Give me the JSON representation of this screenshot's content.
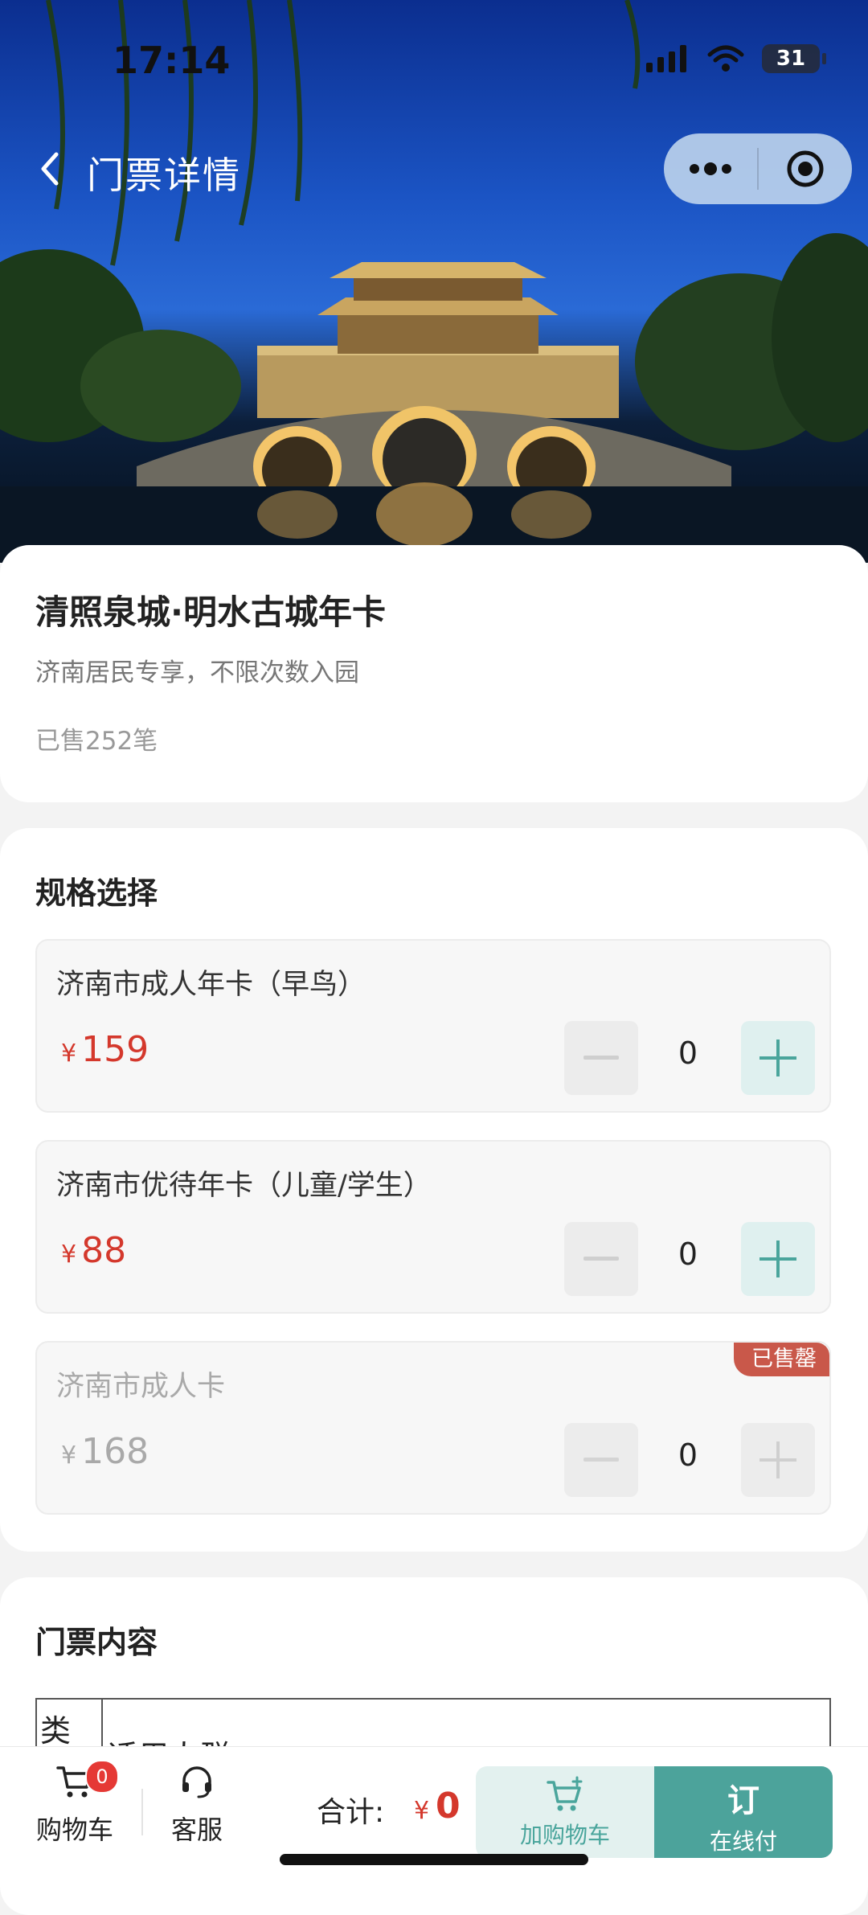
{
  "status_bar": {
    "time": "17:14",
    "battery": "31"
  },
  "navbar": {
    "title": "门票详情"
  },
  "product": {
    "title": "清照泉城·明水古城年卡",
    "subtitle": "济南居民专享，不限次数入园",
    "sold": "已售252笔"
  },
  "spec": {
    "section_title": "规格选择",
    "currency": "¥",
    "options": [
      {
        "name": "济南市成人年卡（早鸟）",
        "price": "159",
        "qty": "0",
        "sold_out": false
      },
      {
        "name": "济南市优待年卡（儿童/学生）",
        "price": "88",
        "qty": "0",
        "sold_out": false
      },
      {
        "name": "济南市成人卡",
        "price": "168",
        "qty": "0",
        "sold_out": true,
        "badge": "已售罄"
      }
    ]
  },
  "content": {
    "section_title": "门票内容",
    "table": {
      "col1": "类",
      "col2": "适用人群"
    }
  },
  "bottom_bar": {
    "cart_label": "购物车",
    "cart_count": "0",
    "service_label": "客服",
    "total_label": "合计:",
    "total_currency": "¥",
    "total_value": "0",
    "add_cart_label": "加购物车",
    "order_big": "订",
    "order_label": "在线付"
  },
  "colors": {
    "accent": "#4ca39b",
    "price": "#d4382c",
    "badge": "#c9584a"
  }
}
